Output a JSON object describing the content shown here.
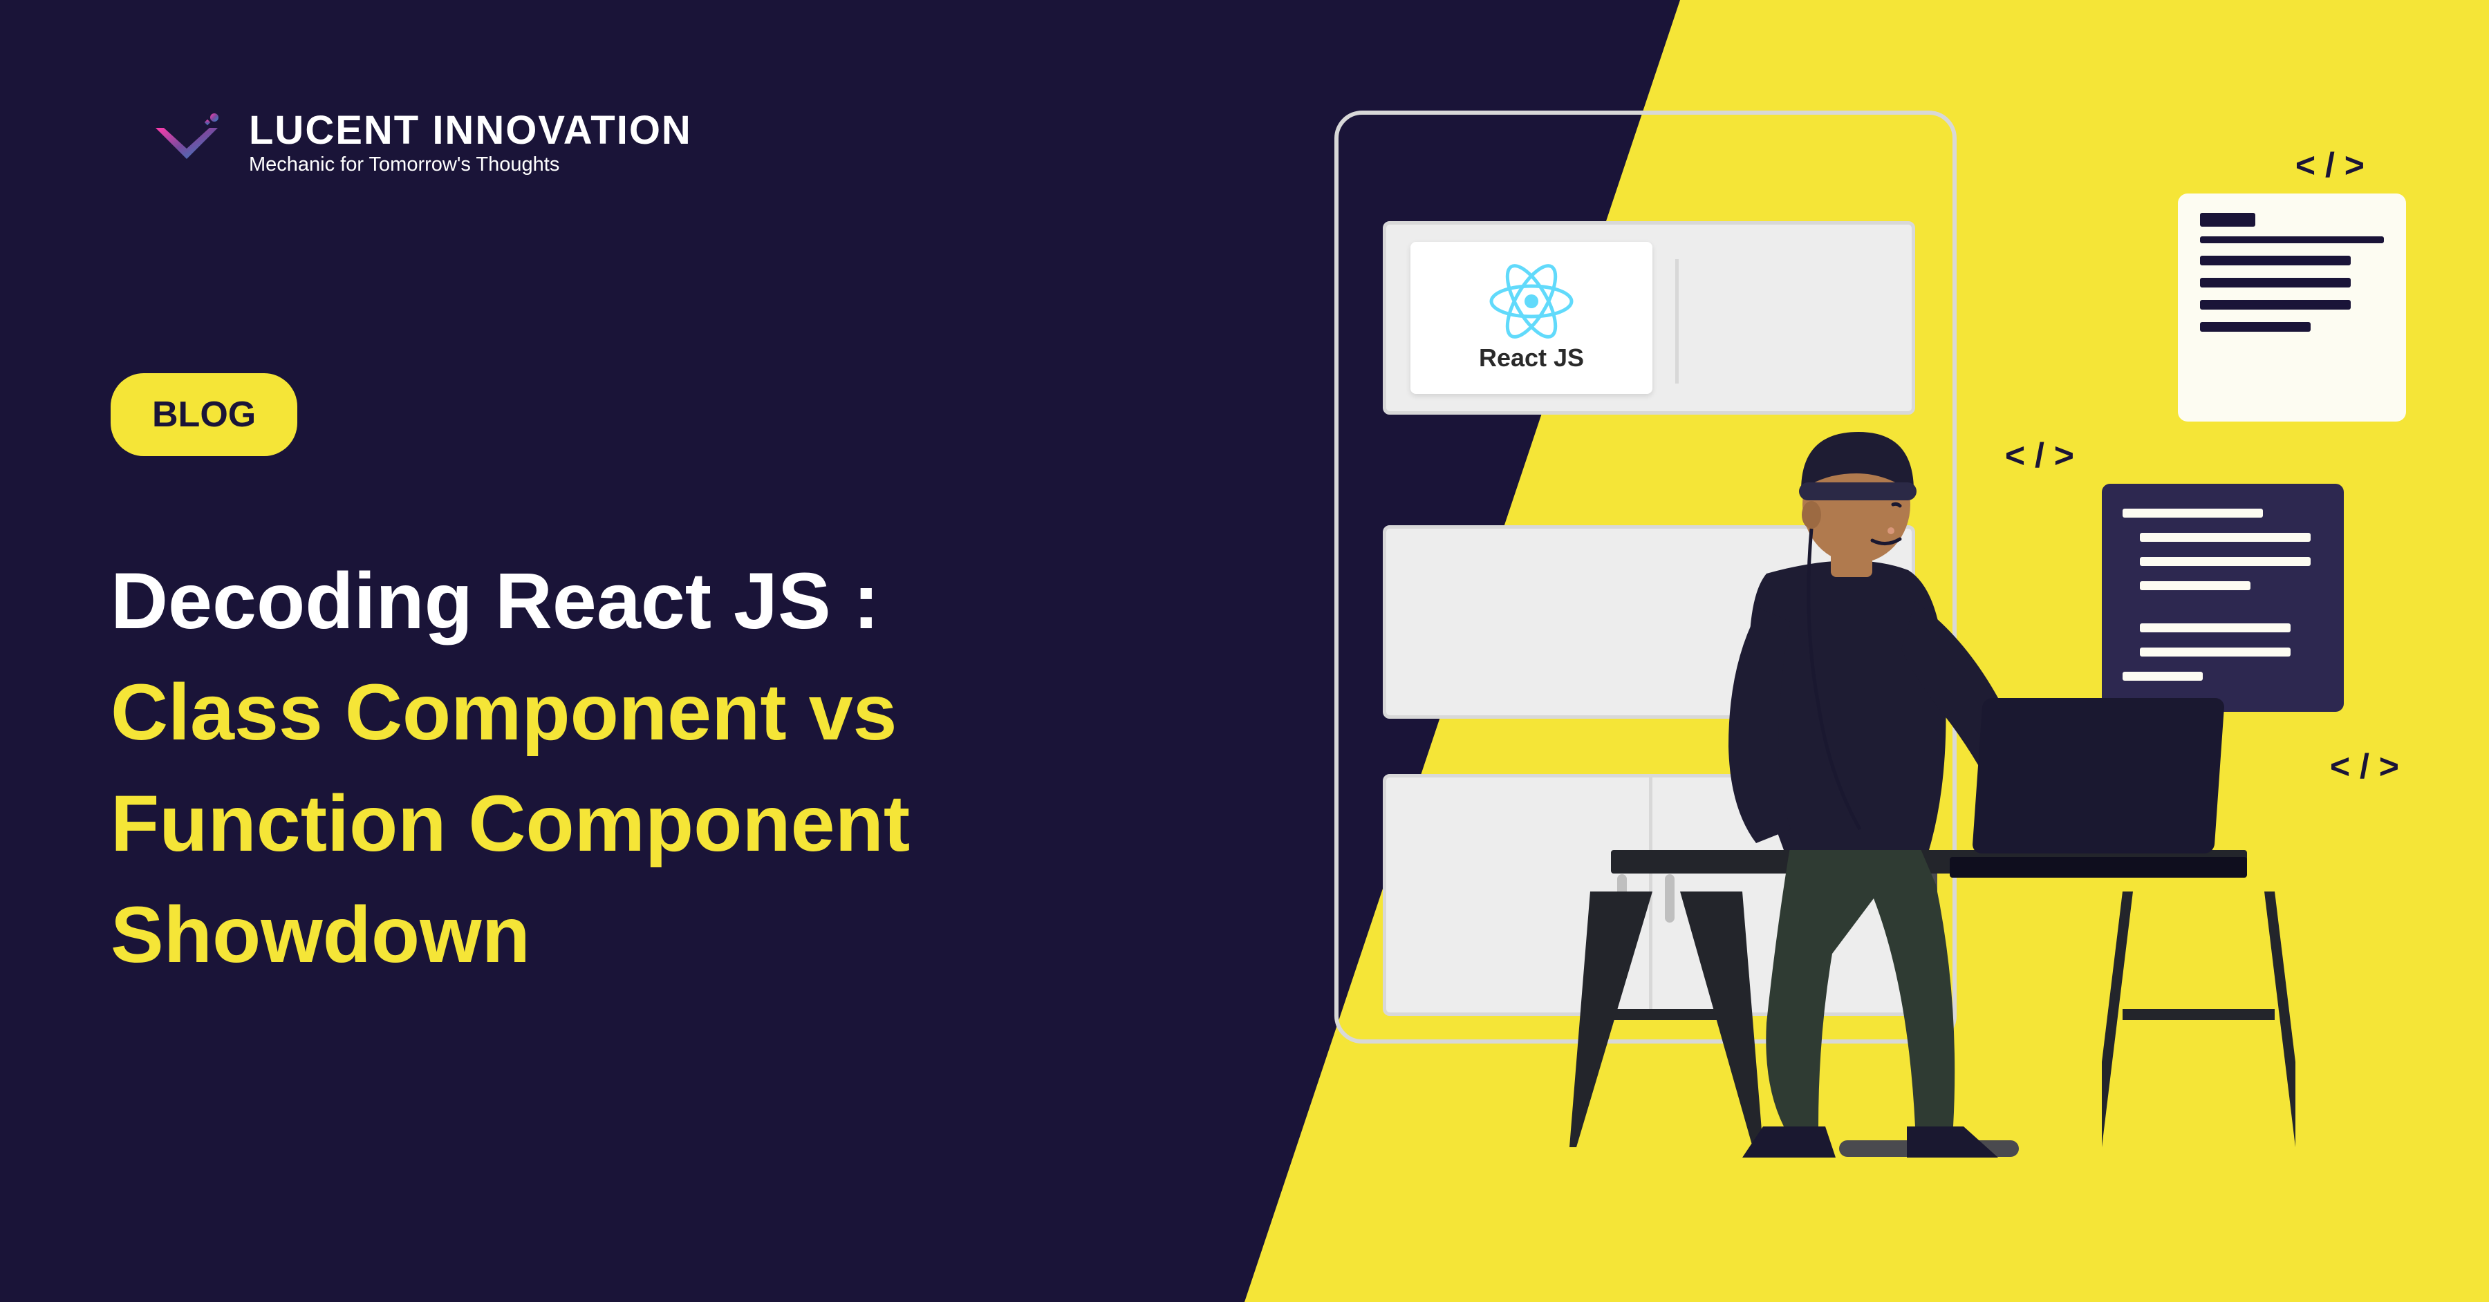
{
  "logo": {
    "title": "LUCENT INNOVATION",
    "tagline": "Mechanic for Tomorrow's Thoughts"
  },
  "badge": {
    "label": "BLOG"
  },
  "heading": {
    "line1": "Decoding React JS :",
    "line2": "Class Component vs",
    "line3": "Function Component",
    "line4": "Showdown"
  },
  "illustration": {
    "react_label": "React JS",
    "code_glyph": "< / >"
  },
  "colors": {
    "background": "#1a1438",
    "accent": "#f5e537",
    "white": "#ffffff",
    "react_blue": "#61dafb"
  }
}
